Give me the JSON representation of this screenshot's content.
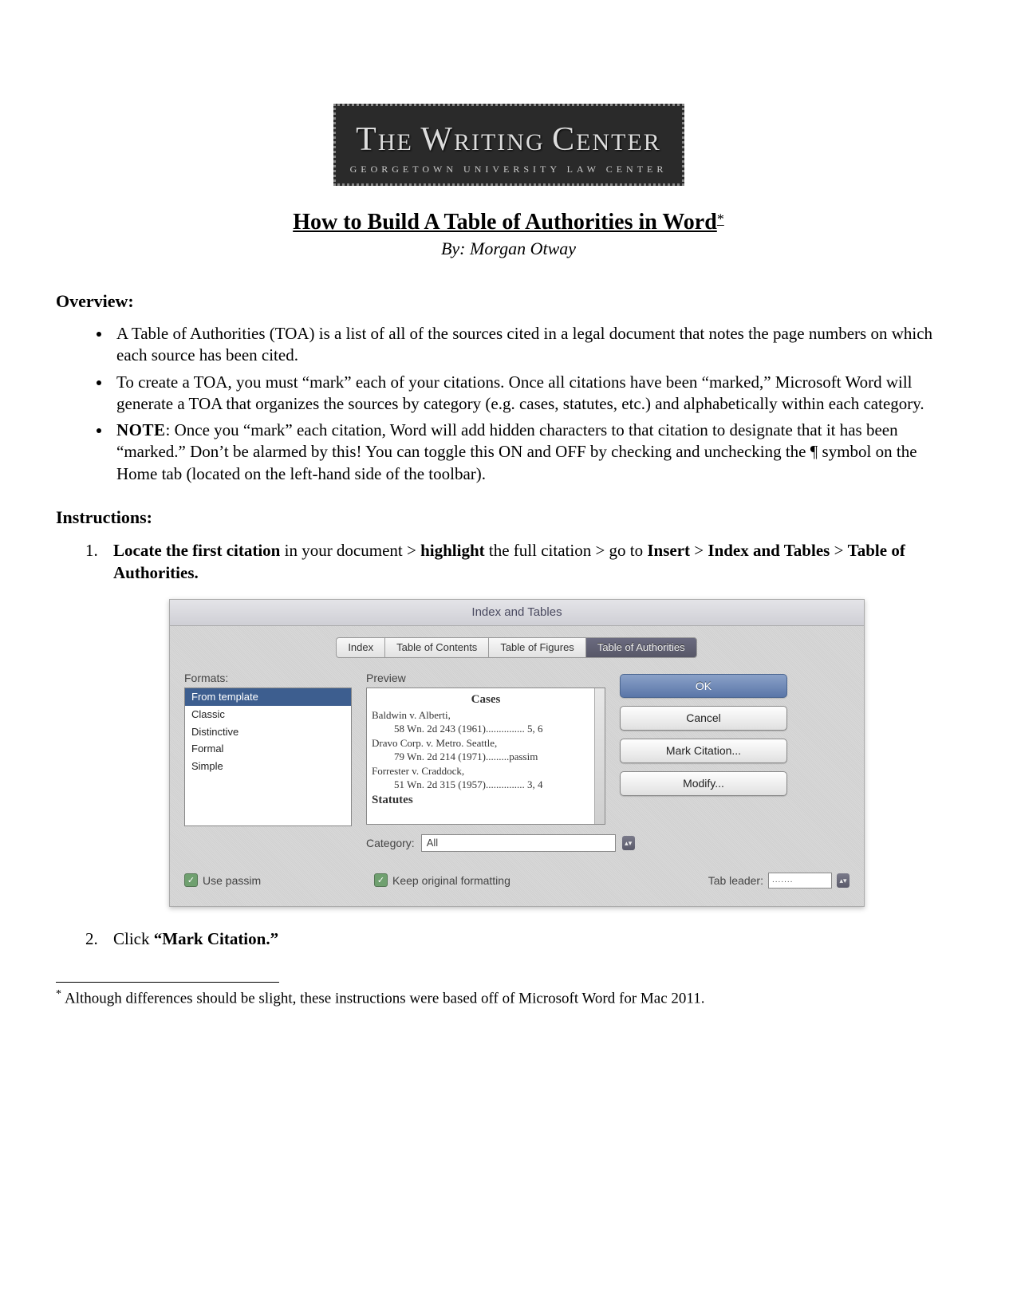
{
  "logo": {
    "line1": "THE WRITING CENTER",
    "line2": "GEORGETOWN UNIVERSITY LAW CENTER"
  },
  "title": "How to Build A Table of Authorities in Word",
  "title_footnote_mark": "*",
  "byline": "By: Morgan Otway",
  "overview_label": "Overview:",
  "overview_items": [
    "A Table of Authorities (TOA) is a list of all of the sources cited in a legal document that notes the page numbers on which each source has been cited.",
    "To create a TOA, you must “mark” each of your citations. Once all citations have been “marked,” Microsoft Word will generate a TOA that organizes the sources by category (e.g. cases, statutes, etc.) and alphabetically within each category."
  ],
  "overview_note_prefix": "NOTE",
  "overview_note_rest": ": Once you “mark” each citation, Word will add hidden characters to that citation to designate that it has been “marked.” Don’t be alarmed by this! You can toggle this ON and OFF by checking and unchecking the ¶ symbol on the Home tab (located on the left-hand side of the toolbar).",
  "instructions_label": "Instructions:",
  "step1": {
    "part1_bold": "Locate the first citation",
    "part2": " in your document > ",
    "part3_bold": "highlight",
    "part4": " the full citation > go to ",
    "part5_bold": "Insert",
    "part6": " > ",
    "part7_bold": "Index and Tables",
    "part8": " > ",
    "part9_bold": "Table of Authorities."
  },
  "step2": {
    "part1": "Click ",
    "part2_bold": "“Mark Citation.”"
  },
  "dialog": {
    "title": "Index and Tables",
    "tabs": [
      "Index",
      "Table of Contents",
      "Table of Figures",
      "Table of Authorities"
    ],
    "active_tab_index": 3,
    "formats_label": "Formats:",
    "formats": [
      "From template",
      "Classic",
      "Distinctive",
      "Formal",
      "Simple"
    ],
    "formats_selected_index": 0,
    "preview_label": "Preview",
    "preview": {
      "heading": "Cases",
      "lines": [
        {
          "main": "Baldwin v. Alberti,",
          "indent": "58 Wn. 2d 243 (1961)............... 5, 6"
        },
        {
          "main": "Dravo Corp. v. Metro. Seattle,",
          "indent": "79 Wn. 2d 214 (1971).........passim"
        },
        {
          "main": "Forrester v. Craddock,",
          "indent": "51 Wn. 2d 315 (1957)............... 3, 4"
        }
      ],
      "footer_heading": "Statutes"
    },
    "buttons": {
      "ok": "OK",
      "cancel": "Cancel",
      "mark_citation": "Mark Citation...",
      "modify": "Modify..."
    },
    "category_label": "Category:",
    "category_value": "All",
    "use_passim_label": "Use passim",
    "keep_formatting_label": "Keep original formatting",
    "tab_leader_label": "Tab leader:",
    "tab_leader_value": "......."
  },
  "footnote": {
    "mark": "*",
    "text": "Although differences should be slight, these instructions were based off of Microsoft Word for Mac 2011."
  }
}
